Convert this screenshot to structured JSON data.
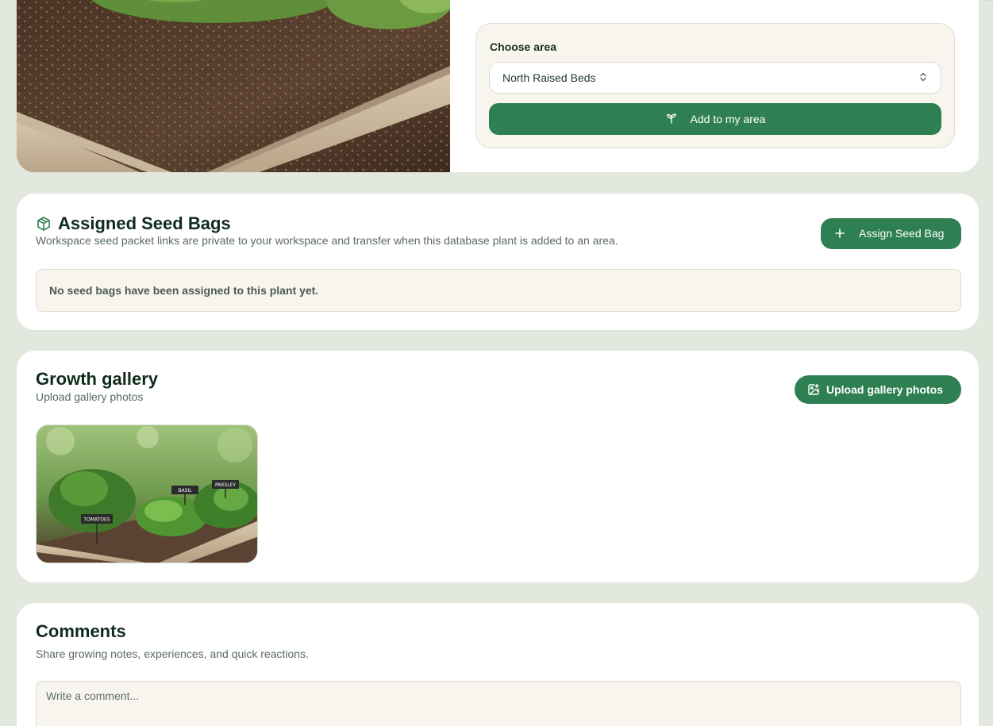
{
  "area_picker": {
    "label": "Choose area",
    "selected": "North Raised Beds",
    "add_button": "Add to my area"
  },
  "seed_bags": {
    "title": "Assigned Seed Bags",
    "subtitle": "Workspace seed packet links are private to your workspace and transfer when this database plant is added to an area.",
    "assign_button": "Assign Seed Bag",
    "empty_message": "No seed bags have been assigned to this plant yet."
  },
  "gallery": {
    "title": "Growth gallery",
    "subtitle": "Upload gallery photos",
    "upload_button": "Upload gallery photos",
    "photos": [
      {
        "labels": [
          "TOMATOES",
          "BASIL",
          "PARSLEY"
        ]
      }
    ]
  },
  "comments": {
    "title": "Comments",
    "subtitle": "Share growing notes, experiences, and quick reactions.",
    "input_placeholder": "Write a comment..."
  },
  "colors": {
    "accent": "#2e8052",
    "background": "#e3e8df",
    "panel": "#f8f5ee"
  },
  "icons": {
    "seed_bags": "package-icon",
    "add_to_area": "sprout-icon",
    "assign": "plus-icon",
    "upload": "image-plus-icon",
    "select": "chevron-up-down-icon"
  }
}
